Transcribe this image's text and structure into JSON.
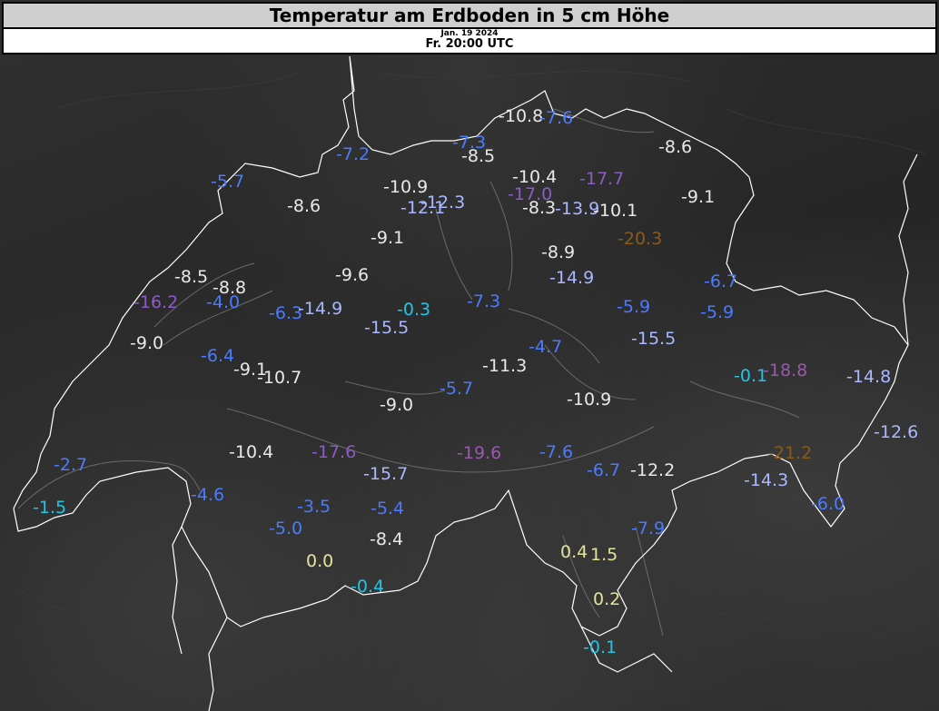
{
  "header": {
    "title": "Temperatur am Erdboden in 5 cm Höhe",
    "date": "Jan. 19 2024",
    "time": "Fr. 20:00 UTC"
  },
  "colors": {
    "white": "#e8e8e8",
    "light_blue": "#a9b8ff",
    "blue": "#4b7bff",
    "cyan": "#22c4e6",
    "purple": "#8a5cc4",
    "dark_purple": "#9a58b0",
    "brown": "#8a5a1a",
    "yellow": "#e3e39a"
  },
  "stations": [
    {
      "value": "-10.8",
      "color": "#e8e8e8"
    },
    {
      "value": "-7.6",
      "color": "#4b7bff"
    },
    {
      "value": "-7.2",
      "color": "#4b7bff"
    },
    {
      "value": "-7.3",
      "color": "#4b7bff"
    },
    {
      "value": "-8.5",
      "color": "#e8e8e8"
    },
    {
      "value": "-8.6",
      "color": "#e8e8e8"
    },
    {
      "value": "-5.7",
      "color": "#4b7bff"
    },
    {
      "value": "-10.9",
      "color": "#e8e8e8"
    },
    {
      "value": "-10.4",
      "color": "#e8e8e8"
    },
    {
      "value": "-17.7",
      "color": "#8a5cc4"
    },
    {
      "value": "-8.6",
      "color": "#e8e8e8"
    },
    {
      "value": "-12.3",
      "color": "#a9b8ff"
    },
    {
      "value": "-17.0",
      "color": "#8a5cc4"
    },
    {
      "value": "-9.1",
      "color": "#e8e8e8"
    },
    {
      "value": "-12.1",
      "color": "#a9b8ff"
    },
    {
      "value": "-8.3",
      "color": "#e8e8e8"
    },
    {
      "value": "-13.9",
      "color": "#a9b8ff"
    },
    {
      "value": "-10.1",
      "color": "#e8e8e8"
    },
    {
      "value": "-9.1",
      "color": "#e8e8e8"
    },
    {
      "value": "-20.3",
      "color": "#8a5a1a"
    },
    {
      "value": "-8.9",
      "color": "#e8e8e8"
    },
    {
      "value": "-9.6",
      "color": "#e8e8e8"
    },
    {
      "value": "-8.5",
      "color": "#e8e8e8"
    },
    {
      "value": "-14.9",
      "color": "#a9b8ff"
    },
    {
      "value": "-6.7",
      "color": "#4b7bff"
    },
    {
      "value": "-8.8",
      "color": "#e8e8e8"
    },
    {
      "value": "-16.2",
      "color": "#8a5cc4"
    },
    {
      "value": "-4.0",
      "color": "#4b7bff"
    },
    {
      "value": "-6.3",
      "color": "#4b7bff"
    },
    {
      "value": "-14.9",
      "color": "#a9b8ff"
    },
    {
      "value": "-0.3",
      "color": "#22c4e6"
    },
    {
      "value": "-7.3",
      "color": "#4b7bff"
    },
    {
      "value": "-5.9",
      "color": "#4b7bff"
    },
    {
      "value": "-5.9",
      "color": "#4b7bff"
    },
    {
      "value": "-15.5",
      "color": "#a9b8ff"
    },
    {
      "value": "-9.0",
      "color": "#e8e8e8"
    },
    {
      "value": "-15.5",
      "color": "#a9b8ff"
    },
    {
      "value": "-4.7",
      "color": "#4b7bff"
    },
    {
      "value": "-6.4",
      "color": "#4b7bff"
    },
    {
      "value": "-9.1",
      "color": "#e8e8e8"
    },
    {
      "value": "-10.7",
      "color": "#e8e8e8"
    },
    {
      "value": "-11.3",
      "color": "#e8e8e8"
    },
    {
      "value": "-0.1",
      "color": "#22c4e6"
    },
    {
      "value": "-18.8",
      "color": "#9a58b0"
    },
    {
      "value": "-14.8",
      "color": "#a9b8ff"
    },
    {
      "value": "-5.7",
      "color": "#4b7bff"
    },
    {
      "value": "-9.0",
      "color": "#e8e8e8"
    },
    {
      "value": "-10.9",
      "color": "#e8e8e8"
    },
    {
      "value": "-12.6",
      "color": "#a9b8ff"
    },
    {
      "value": "-10.4",
      "color": "#e8e8e8"
    },
    {
      "value": "-17.6",
      "color": "#8a5cc4"
    },
    {
      "value": "-19.6",
      "color": "#9a58b0"
    },
    {
      "value": "-7.6",
      "color": "#4b7bff"
    },
    {
      "value": "-21.2",
      "color": "#8a5a1a"
    },
    {
      "value": "-2.7",
      "color": "#4b7bff"
    },
    {
      "value": "-15.7",
      "color": "#a9b8ff"
    },
    {
      "value": "-6.7",
      "color": "#4b7bff"
    },
    {
      "value": "-12.2",
      "color": "#e8e8e8"
    },
    {
      "value": "-14.3",
      "color": "#a9b8ff"
    },
    {
      "value": "-4.6",
      "color": "#4b7bff"
    },
    {
      "value": "-6.0",
      "color": "#4b7bff"
    },
    {
      "value": "-1.5",
      "color": "#22c4e6"
    },
    {
      "value": "-3.5",
      "color": "#4b7bff"
    },
    {
      "value": "-5.4",
      "color": "#4b7bff"
    },
    {
      "value": "-5.0",
      "color": "#4b7bff"
    },
    {
      "value": "-7.9",
      "color": "#4b7bff"
    },
    {
      "value": "-8.4",
      "color": "#e8e8e8"
    },
    {
      "value": "0.4",
      "color": "#e3e39a"
    },
    {
      "value": "1.5",
      "color": "#e3e39a"
    },
    {
      "value": "0.0",
      "color": "#e3e39a"
    },
    {
      "value": "-0.4",
      "color": "#22c4e6"
    },
    {
      "value": "0.2",
      "color": "#e3e39a"
    },
    {
      "value": "-0.1",
      "color": "#22c4e6"
    }
  ]
}
